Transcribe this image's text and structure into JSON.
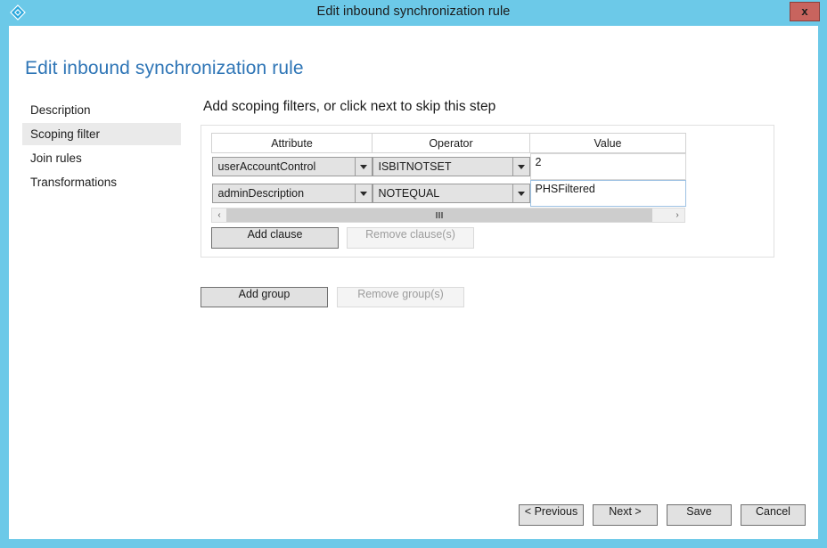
{
  "window": {
    "title": "Edit inbound synchronization rule",
    "icon": "azure-diamond-icon",
    "close_label": "x",
    "titlebar_color": "#6cc9e8",
    "close_color": "#c8645e"
  },
  "page": {
    "heading": "Edit inbound synchronization rule",
    "heading_color": "#2e75b6"
  },
  "sidebar": {
    "items": [
      {
        "label": "Description",
        "selected": false
      },
      {
        "label": "Scoping filter",
        "selected": true
      },
      {
        "label": "Join rules",
        "selected": false
      },
      {
        "label": "Transformations",
        "selected": false
      }
    ]
  },
  "main": {
    "step_heading": "Add scoping filters, or click next to skip this step",
    "table": {
      "columns": [
        "Attribute",
        "Operator",
        "Value"
      ],
      "rows": [
        {
          "attribute": "userAccountControl",
          "operator": "ISBITNOTSET",
          "value": "2",
          "value_focused": false
        },
        {
          "attribute": "adminDescription",
          "operator": "NOTEQUAL",
          "value": "PHSFiltered",
          "value_focused": true
        }
      ]
    },
    "scrollbar": {
      "left_arrow": "‹",
      "right_arrow": "›"
    },
    "clause_buttons": {
      "add": "Add clause",
      "remove": "Remove clause(s)",
      "remove_disabled": true
    },
    "group_buttons": {
      "add": "Add group",
      "remove": "Remove group(s)",
      "remove_disabled": true
    }
  },
  "footer": {
    "buttons": [
      {
        "label": "< Previous"
      },
      {
        "label": "Next >"
      },
      {
        "label": "Save"
      },
      {
        "label": "Cancel"
      }
    ]
  }
}
